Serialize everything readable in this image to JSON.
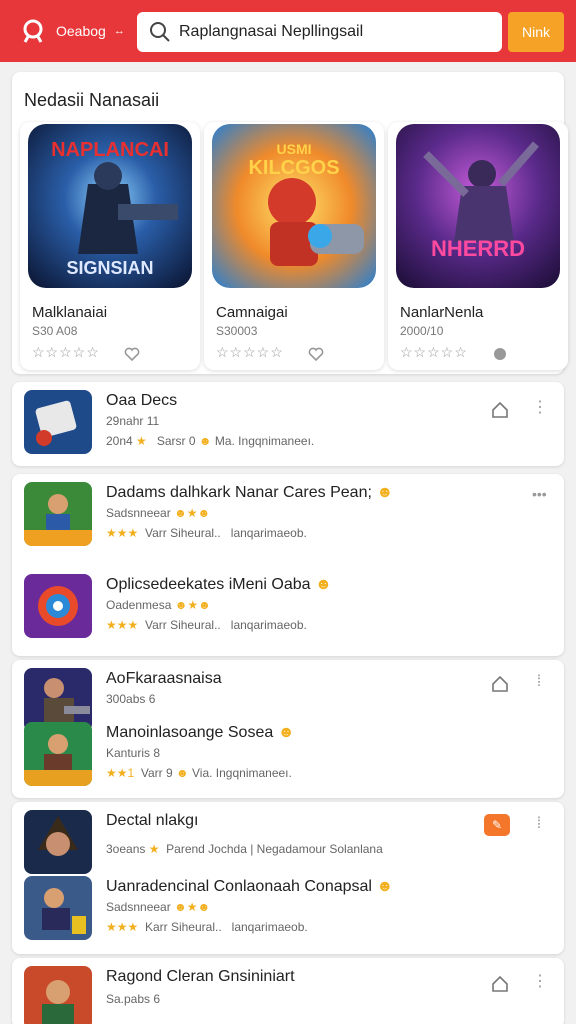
{
  "topbar": {
    "brand": "Oeabog",
    "caret": "↔",
    "search_value": "Raplangnasai Nepllingsail",
    "button": "Nink"
  },
  "featured": {
    "title": "Nedasii Nanasaii",
    "items": [
      {
        "name": "Malklanaiai",
        "sub": "S30 A08",
        "stars": "☆☆☆☆☆",
        "art_text": "NAPLANCAI",
        "art_text2": "SIGNSIAN"
      },
      {
        "name": "Camnaigai",
        "sub": "S30003",
        "stars": "☆☆☆☆☆",
        "art_text": "USMI",
        "art_text2": "KILCGOS"
      },
      {
        "name": "NanlarNenla",
        "sub": "2000/10",
        "stars": "☆☆☆☆☆",
        "art_text": "NHERRD",
        "art_text2": ""
      }
    ]
  },
  "list": [
    {
      "title": "Oaa Decs",
      "line2": "29nahr 11",
      "line3_a": "20n4",
      "line3_b": "Sarsr 0",
      "line3_c": "Ma.  Ingqnimaneeı.",
      "line3_stars": "★"
    },
    {
      "title": "Dadams dalhkark Nanar Cares Pean;",
      "line2": "Sadsnneear",
      "line3_stars": "★★★",
      "line3_a": "Varr Siheural..",
      "line3_c": "lanqarimaeob."
    },
    {
      "title": "Oplicsedeekates iMeni Oaba",
      "line2": "Oadenmesa",
      "line3_stars": "★★★",
      "line3_a": "Varr Siheural..",
      "line3_c": "lanqarimaeob."
    },
    {
      "title": "AoFkaraasnaisa",
      "line2": "300abs 6",
      "line3_a": "",
      "line3_c": ""
    },
    {
      "title": "Manoinlasoange Sosea",
      "line2": "Kanturis 8",
      "line3_stars": "★★1",
      "line3_a": "Varr 9",
      "line3_c": "Via. Ingqnimaneeı."
    },
    {
      "title": "Dectal nlakgı",
      "line2": "3oeans",
      "line2_b": "Parend Jochda | Negadamour Solanlana",
      "line3_a": ""
    },
    {
      "title": "Uanradencinal Conlaonaah Conapsal",
      "line2": "Sadsnneear",
      "line3_stars": "★★★",
      "line3_a": "Karr Siheural..",
      "line3_c": "lanqarimaeob."
    },
    {
      "title": "Ragond Cleran Gnsininiart",
      "line2": "Sa.pabs 6",
      "line3_a": ""
    }
  ]
}
